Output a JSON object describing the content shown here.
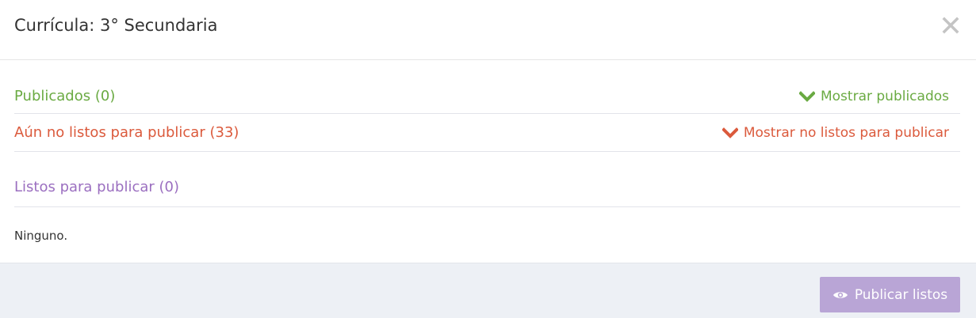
{
  "modal": {
    "title": "Currícula: 3° Secundaria",
    "close_icon": "close-icon"
  },
  "sections": {
    "published": {
      "label": "Publicados (0)",
      "toggle_label": "Mostrar publicados",
      "toggle_icon": "chevron-down-icon",
      "color": "#6aaa42"
    },
    "not_ready": {
      "label": "Aún no listos para publicar (33)",
      "toggle_label": "Mostrar no listos para publicar",
      "toggle_icon": "chevron-down-icon",
      "color": "#db5a3c"
    },
    "ready": {
      "label": "Listos para publicar (0)",
      "color": "#9b6fc0",
      "empty_text": "Ninguno."
    }
  },
  "footer": {
    "publish_button_label": "Publicar listos",
    "publish_button_icon": "eye-icon",
    "publish_button_color": "#b9a5d6"
  }
}
